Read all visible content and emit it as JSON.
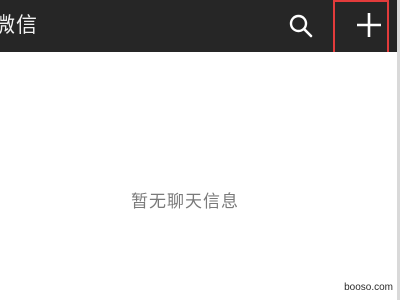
{
  "header": {
    "title": "微信",
    "search_icon": "search-icon",
    "add_icon": "plus-icon"
  },
  "main": {
    "empty_message": "暂无聊天信息"
  },
  "watermark": {
    "text": "booso.com"
  },
  "colors": {
    "topbar_bg": "#262626",
    "highlight_border": "#e23b3b",
    "empty_text": "#7a7a7a"
  }
}
